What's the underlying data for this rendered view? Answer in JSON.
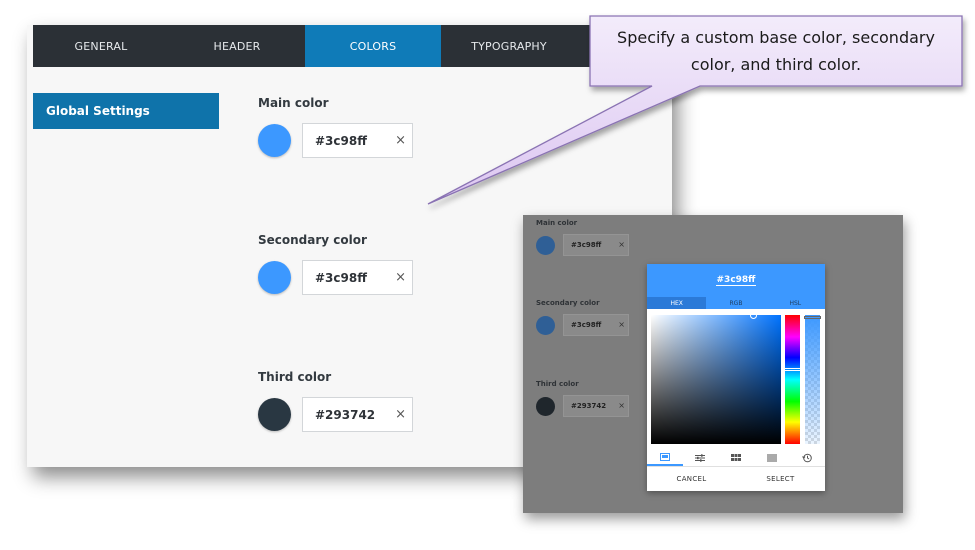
{
  "tabs": [
    "GENERAL",
    "HEADER",
    "COLORS",
    "TYPOGRAPHY"
  ],
  "active_tab": "COLORS",
  "sidebar": {
    "items": [
      {
        "label": "Global Settings",
        "active": true
      }
    ]
  },
  "fields": [
    {
      "label": "Main color",
      "value": "#3c98ff",
      "color": "#3c98ff"
    },
    {
      "label": "Secondary color",
      "value": "#3c98ff",
      "color": "#3c98ff"
    },
    {
      "label": "Third color",
      "value": "#293742",
      "color": "#293742"
    }
  ],
  "clear_icon": "×",
  "overlay": {
    "fields": [
      {
        "label": "Main color",
        "value": "#3c98ff",
        "color": "#2f5f96"
      },
      {
        "label": "Secondary color",
        "value": "#3c98ff",
        "color": "#2f5f96"
      },
      {
        "label": "Third color",
        "value": "#293742",
        "color": "#1f262c"
      }
    ],
    "picker": {
      "hex": "#3c98ff",
      "modes": [
        "HEX",
        "RGB",
        "HSL"
      ],
      "active_mode": "HEX",
      "icons": [
        "palette-icon",
        "sliders-icon",
        "swatches-grid-icon",
        "list-icon",
        "history-icon"
      ],
      "cancel_label": "CANCEL",
      "select_label": "SELECT"
    }
  },
  "callout": {
    "text": "Specify a custom base color, secondary color, and third color."
  },
  "colors": {
    "accent": "#3c98ff",
    "tab_active": "#0f7bb8",
    "tabbar": "#2b3036",
    "callout_fill": "#e6d6f5",
    "callout_border": "#8a73b3"
  }
}
